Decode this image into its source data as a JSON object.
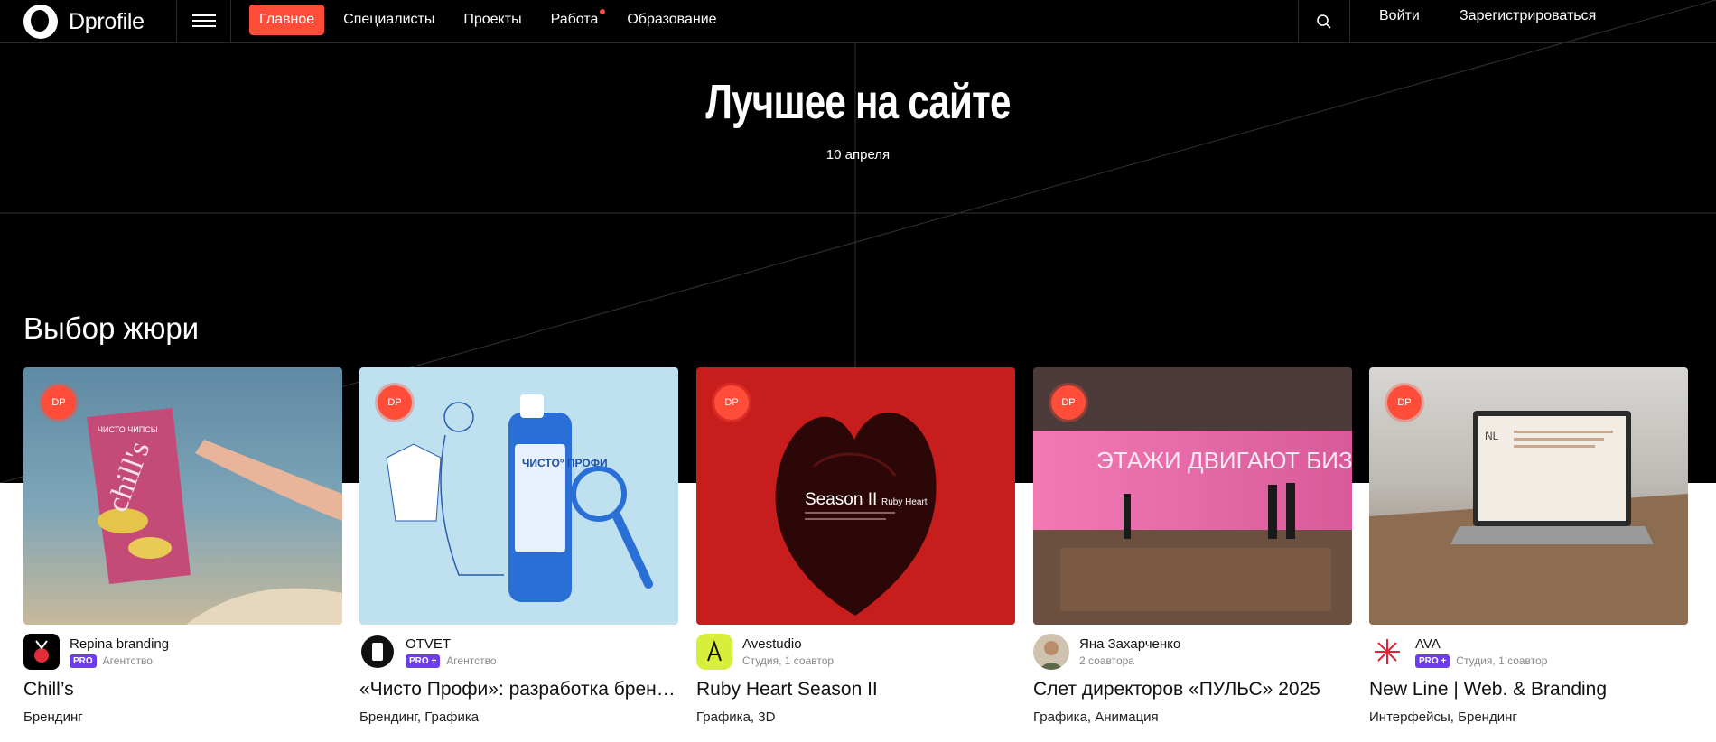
{
  "brand": {
    "name": "Dprofile",
    "accent": "#ff4d3a",
    "pro_color": "#6d3cf0"
  },
  "nav": {
    "menu_icon": "hamburger-icon",
    "items": [
      {
        "label": "Главное",
        "active": true
      },
      {
        "label": "Специалисты"
      },
      {
        "label": "Проекты"
      },
      {
        "label": "Работа",
        "has_dot": true
      },
      {
        "label": "Образование"
      }
    ],
    "search_icon": "search-icon",
    "login": "Войти",
    "register": "Зарегистрироваться"
  },
  "hero": {
    "title": "Лучшее на сайте",
    "date": "10 апреля"
  },
  "section": {
    "title": "Выбор жюри"
  },
  "badge": "DP",
  "cards": [
    {
      "author": "Repina branding",
      "pro": "PRO",
      "meta": "Агентство",
      "title": "Chill’s",
      "tags": "Брендинг"
    },
    {
      "author": "OTVET",
      "pro": "PRO +",
      "meta": "Агентство",
      "title": "«Чисто Профи»: разработка бренда для...",
      "tags": "Брендинг, Графика"
    },
    {
      "author": "Avestudio",
      "pro": "",
      "meta": "Студия, 1 соавтор",
      "title": "Ruby Heart Season II",
      "tags": "Графика, 3D"
    },
    {
      "author": "Яна Захарченко",
      "pro": "",
      "meta": "2 соавтора",
      "title": "Слет директоров «ПУЛЬС» 2025",
      "tags": "Графика, Анимация"
    },
    {
      "author": "AVA",
      "pro": "PRO +",
      "meta": "Студия, 1 соавтор",
      "title": "New Line | Web. & Branding",
      "tags": "Интерфейсы, Брендинг"
    }
  ],
  "artwork": {
    "chips_brand": "chill's",
    "chips_label": "ЧИСТО ЧИПСЫ",
    "bottle_label": "ЧИСТО° ПРОФИ",
    "heart_title": "Season II",
    "heart_subtitle": "Ruby Heart",
    "screen_text": "ЭТАЖИ ДВИГАЮТ БИЗНЕС ВВЕРХ",
    "laptop_logo": "NL"
  }
}
